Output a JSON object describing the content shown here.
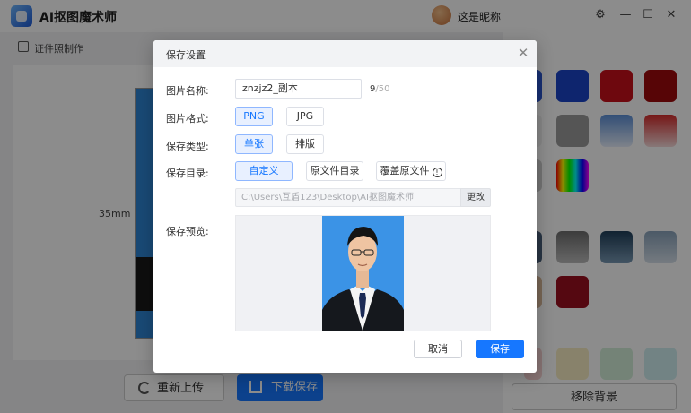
{
  "app": {
    "title": "AI抠图魔术师",
    "user_name": "这是昵称",
    "breadcrumb": "证件照制作",
    "dimension_label": "35mm",
    "reupload_label": "重新上传",
    "download_label": "下载保存",
    "remove_bg_label": "移除背景",
    "background_swatches": [
      "#2a57d0",
      "#c8101b",
      "#9e0a0c",
      "#9b9b9b",
      "#5b8fd8",
      "#d62a2a",
      "#rainbow",
      "#6e6e6e",
      "#3a5f7a",
      "#8aa3bb",
      "#9b1020"
    ]
  },
  "dialog": {
    "title": "保存设置",
    "name_label": "图片名称:",
    "name_value": "znzjz2_副本",
    "name_count": "9",
    "name_max": "/50",
    "format_label": "图片格式:",
    "format_options": [
      "PNG",
      "JPG"
    ],
    "format_selected": "PNG",
    "type_label": "保存类型:",
    "type_options": [
      "单张",
      "排版"
    ],
    "type_selected": "单张",
    "dir_label": "保存目录:",
    "dir_options": [
      "自定义",
      "原文件目录",
      "覆盖原文件"
    ],
    "dir_selected": "自定义",
    "path_value": "C:\\Users\\互盾123\\Desktop\\AI抠图魔术师",
    "change_label": "更改",
    "preview_label": "保存预览:",
    "cancel_label": "取消",
    "save_label": "保存"
  },
  "colors": {
    "accent": "#1677ff",
    "photo_background": "#3b93e6"
  }
}
